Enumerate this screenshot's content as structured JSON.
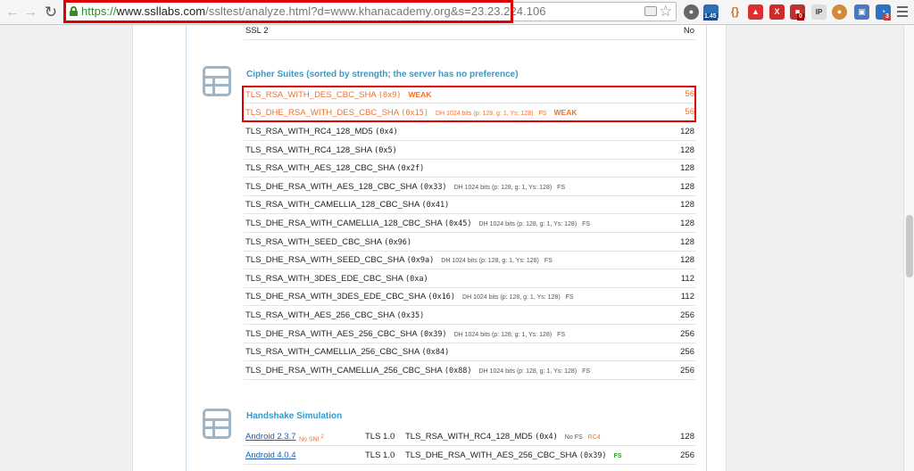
{
  "browser": {
    "url_scheme": "https://",
    "url_host": "www.ssllabs.com",
    "url_rest": "/ssltest/analyze.html?d=www.khanacademy.org&s=23.23.224.106",
    "ext_badge_1": "1.45",
    "ext_badge_2": "0",
    "ext_badge_3": "3"
  },
  "protocols": {
    "last_row": {
      "name": "SSL 2",
      "value": "No"
    }
  },
  "cipher_section": {
    "title": "Cipher Suites (sorted by strength; the server has no preference)",
    "weak_rows": [
      {
        "name": "TLS_RSA_WITH_DES_CBC_SHA",
        "code": "(0x9)",
        "dh": "",
        "fs": "",
        "weak": "WEAK",
        "value": "56"
      },
      {
        "name": "TLS_DHE_RSA_WITH_DES_CBC_SHA",
        "code": "(0x15)",
        "dh": "DH 1024 bits (p: 128, g: 1, Ys: 128)",
        "fs": "FS",
        "weak": "WEAK",
        "value": "56"
      }
    ],
    "rows": [
      {
        "name": "TLS_RSA_WITH_RC4_128_MD5",
        "code": "(0x4)",
        "dh": "",
        "fs": "",
        "value": "128"
      },
      {
        "name": "TLS_RSA_WITH_RC4_128_SHA",
        "code": "(0x5)",
        "dh": "",
        "fs": "",
        "value": "128"
      },
      {
        "name": "TLS_RSA_WITH_AES_128_CBC_SHA",
        "code": "(0x2f)",
        "dh": "",
        "fs": "",
        "value": "128"
      },
      {
        "name": "TLS_DHE_RSA_WITH_AES_128_CBC_SHA",
        "code": "(0x33)",
        "dh": "DH 1024 bits (p: 128, g: 1, Ys: 128)",
        "fs": "FS",
        "value": "128"
      },
      {
        "name": "TLS_RSA_WITH_CAMELLIA_128_CBC_SHA",
        "code": "(0x41)",
        "dh": "",
        "fs": "",
        "value": "128"
      },
      {
        "name": "TLS_DHE_RSA_WITH_CAMELLIA_128_CBC_SHA",
        "code": "(0x45)",
        "dh": "DH 1024 bits (p: 128, g: 1, Ys: 128)",
        "fs": "FS",
        "value": "128"
      },
      {
        "name": "TLS_RSA_WITH_SEED_CBC_SHA",
        "code": "(0x96)",
        "dh": "",
        "fs": "",
        "value": "128"
      },
      {
        "name": "TLS_DHE_RSA_WITH_SEED_CBC_SHA",
        "code": "(0x9a)",
        "dh": "DH 1024 bits (p: 128, g: 1, Ys: 128)",
        "fs": "FS",
        "value": "128"
      },
      {
        "name": "TLS_RSA_WITH_3DES_EDE_CBC_SHA",
        "code": "(0xa)",
        "dh": "",
        "fs": "",
        "value": "112"
      },
      {
        "name": "TLS_DHE_RSA_WITH_3DES_EDE_CBC_SHA",
        "code": "(0x16)",
        "dh": "DH 1024 bits (p: 128, g: 1, Ys: 128)",
        "fs": "FS",
        "value": "112"
      },
      {
        "name": "TLS_RSA_WITH_AES_256_CBC_SHA",
        "code": "(0x35)",
        "dh": "",
        "fs": "",
        "value": "256"
      },
      {
        "name": "TLS_DHE_RSA_WITH_AES_256_CBC_SHA",
        "code": "(0x39)",
        "dh": "DH 1024 bits (p: 128, g: 1, Ys: 128)",
        "fs": "FS",
        "value": "256"
      },
      {
        "name": "TLS_RSA_WITH_CAMELLIA_256_CBC_SHA",
        "code": "(0x84)",
        "dh": "",
        "fs": "",
        "value": "256"
      },
      {
        "name": "TLS_DHE_RSA_WITH_CAMELLIA_256_CBC_SHA",
        "code": "(0x88)",
        "dh": "DH 1024 bits (p: 128, g: 1, Ys: 128)",
        "fs": "FS",
        "value": "256"
      }
    ]
  },
  "handshake_section": {
    "title": "Handshake Simulation",
    "rows": [
      {
        "client": "Android 2.3.7",
        "nosni": "No SNI",
        "nosni_sup": "2",
        "protocol": "TLS 1.0",
        "suite": "TLS_RSA_WITH_RC4_128_MD5",
        "code": "(0x4)",
        "tag1": "No FS",
        "tag2": "RC4",
        "value": "128"
      },
      {
        "client": "Android 4.0.4",
        "nosni": "",
        "nosni_sup": "",
        "protocol": "TLS 1.0",
        "suite": "TLS_DHE_RSA_WITH_AES_256_CBC_SHA",
        "code": "(0x39)",
        "tag1": "FS",
        "tag2": "",
        "value": "256"
      }
    ]
  }
}
